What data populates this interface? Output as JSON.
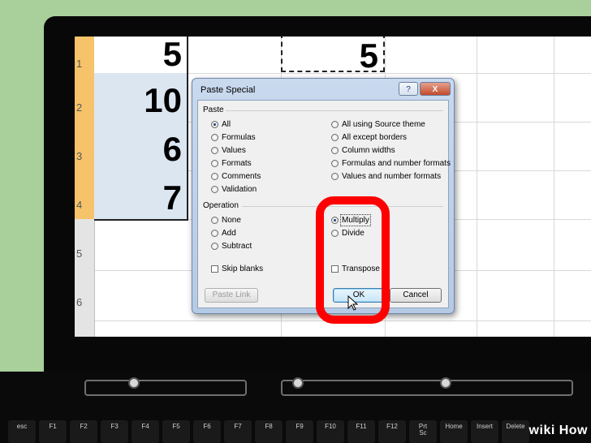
{
  "spreadsheet": {
    "row_numbers": [
      "1",
      "2",
      "3",
      "4",
      "5",
      "6"
    ],
    "column_values": [
      "5",
      "10",
      "6",
      "7"
    ],
    "copied_value": "5"
  },
  "dialog": {
    "title": "Paste Special",
    "help_button": "?",
    "close_button": "X",
    "paste_section": {
      "label": "Paste",
      "options_left": [
        "All",
        "Formulas",
        "Values",
        "Formats",
        "Comments",
        "Validation"
      ],
      "options_right": [
        "All using Source theme",
        "All except borders",
        "Column widths",
        "Formulas and number formats",
        "Values and number formats"
      ],
      "selected": "All"
    },
    "operation_section": {
      "label": "Operation",
      "options_left": [
        "None",
        "Add",
        "Subtract"
      ],
      "options_right": [
        "Multiply",
        "Divide"
      ],
      "selected": "Multiply"
    },
    "skip_blanks_label": "Skip blanks",
    "transpose_label": "Transpose",
    "paste_link_button": "Paste Link",
    "ok_button": "OK",
    "cancel_button": "Cancel"
  },
  "keyboard": {
    "keys": [
      "esc",
      "F1",
      "F2",
      "F3",
      "F4",
      "F5",
      "F6",
      "F7",
      "F8",
      "F9",
      "F10",
      "F11",
      "F12",
      "Prt\nSc",
      "Home",
      "Insert",
      "Delete"
    ]
  },
  "watermark": "wiki How",
  "colors": {
    "background": "#a9cf9b",
    "highlight": "#ff0000",
    "selected_row_header": "#f7c36a",
    "selection_fill": "#dce6f1"
  }
}
